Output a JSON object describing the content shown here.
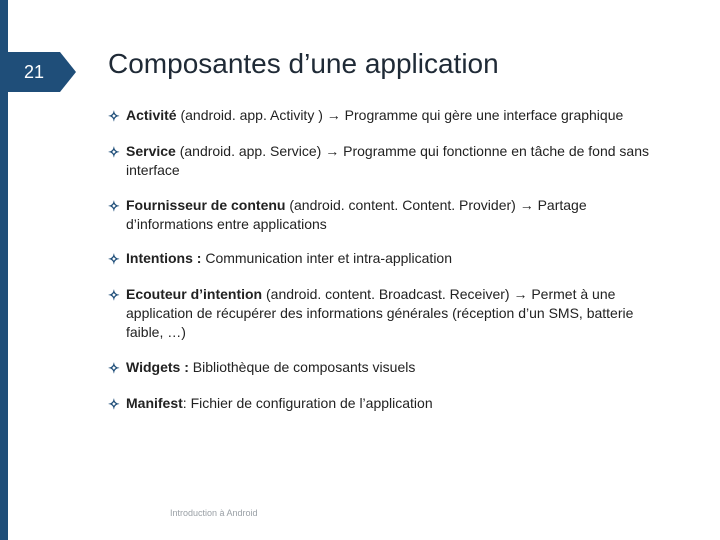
{
  "slide": {
    "number": "21",
    "title": "Composantes d’une application",
    "items": [
      {
        "bold": "Activité",
        "paren": " (android. app. Activity ) ",
        "arrow": "→",
        "rest": " Programme qui gère une interface graphique"
      },
      {
        "bold": "Service",
        "paren": " (android. app. Service) ",
        "arrow": "→",
        "rest": "  Programme qui fonctionne en tâche de fond sans interface"
      },
      {
        "bold": "Fournisseur de contenu",
        "paren": " (android. content. Content. Provider) ",
        "arrow": "→",
        "rest": " Partage d’informations entre applications"
      },
      {
        "bold": "Intentions :",
        "paren": "",
        "arrow": "",
        "rest": " Communication inter et intra-application"
      },
      {
        "bold": "Ecouteur d’intention",
        "paren": "  (android. content. Broadcast. Receiver) ",
        "arrow": "→",
        "rest": " Permet à une application de récupérer des informations générales (réception d’un SMS, batterie faible, …)"
      },
      {
        "bold": "Widgets :",
        "paren": "",
        "arrow": "",
        "rest": " Bibliothèque de composants visuels"
      },
      {
        "bold": "Manifest",
        "paren": "",
        "arrow": "",
        "rest": ": Fichier de configuration de l’application"
      }
    ],
    "footer": "Introduction à Android",
    "marker": "✧"
  }
}
